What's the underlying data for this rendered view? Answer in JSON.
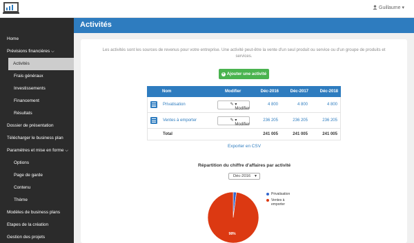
{
  "topbar": {
    "user": "Guillaume ▾"
  },
  "sidebar": {
    "items": [
      {
        "label": "Home"
      },
      {
        "label": "Prévisions financières"
      },
      {
        "label": "Activités"
      },
      {
        "label": "Frais généraux"
      },
      {
        "label": "Investissements"
      },
      {
        "label": "Financement"
      },
      {
        "label": "Résultats"
      },
      {
        "label": "Dossier de présentation"
      },
      {
        "label": "Télécharger le business plan"
      },
      {
        "label": "Paramètres et mise en forme"
      },
      {
        "label": "Options"
      },
      {
        "label": "Page de garde"
      },
      {
        "label": "Contenu"
      },
      {
        "label": "Thème"
      },
      {
        "label": "Modèles de business plans"
      },
      {
        "label": "Etapes de la création"
      },
      {
        "label": "Gestion des projets"
      }
    ]
  },
  "header": {
    "title": "Activités"
  },
  "main": {
    "intro": "Les activités sont les sources de revenus pour votre entreprise. Une activité peut-être la vente d'un seul produit ou service ou d'un groupe de produits et services.",
    "add_button": "Ajouter une activité",
    "table": {
      "headers": {
        "nom": "Nom",
        "modifier": "Modifier",
        "y1": "Déc-2016",
        "y2": "Déc-2017",
        "y3": "Déc-2018"
      },
      "rows": [
        {
          "nom": "Privatisation",
          "modifier": "Modifier",
          "y1": "4 800",
          "y2": "4 800",
          "y3": "4 800"
        },
        {
          "nom": "Ventes à emporter",
          "modifier": "Modifier",
          "y1": "236 205",
          "y2": "236 205",
          "y3": "236 205"
        }
      ],
      "total": {
        "label": "Total",
        "y1": "241 005",
        "y2": "241 005",
        "y3": "241 005"
      }
    },
    "export_link": "Exporter en CSV",
    "chart_title": "Répartition du chiffre d'affaires par activité",
    "period_select": "Déc-2016"
  },
  "chart_data": {
    "type": "pie",
    "title": "Répartition du chiffre d'affaires par activité",
    "labels": [
      "Privatisation",
      "Ventes à emporter"
    ],
    "values": [
      4800,
      236205
    ],
    "slice_labels": [
      "",
      "98%"
    ],
    "colors": [
      "#3366cc",
      "#dc3912"
    ],
    "legend_position": "right"
  },
  "colors": {
    "primary": "#2e7cbf",
    "success": "#4ab34f",
    "sidebar": "#2b2b2b"
  }
}
